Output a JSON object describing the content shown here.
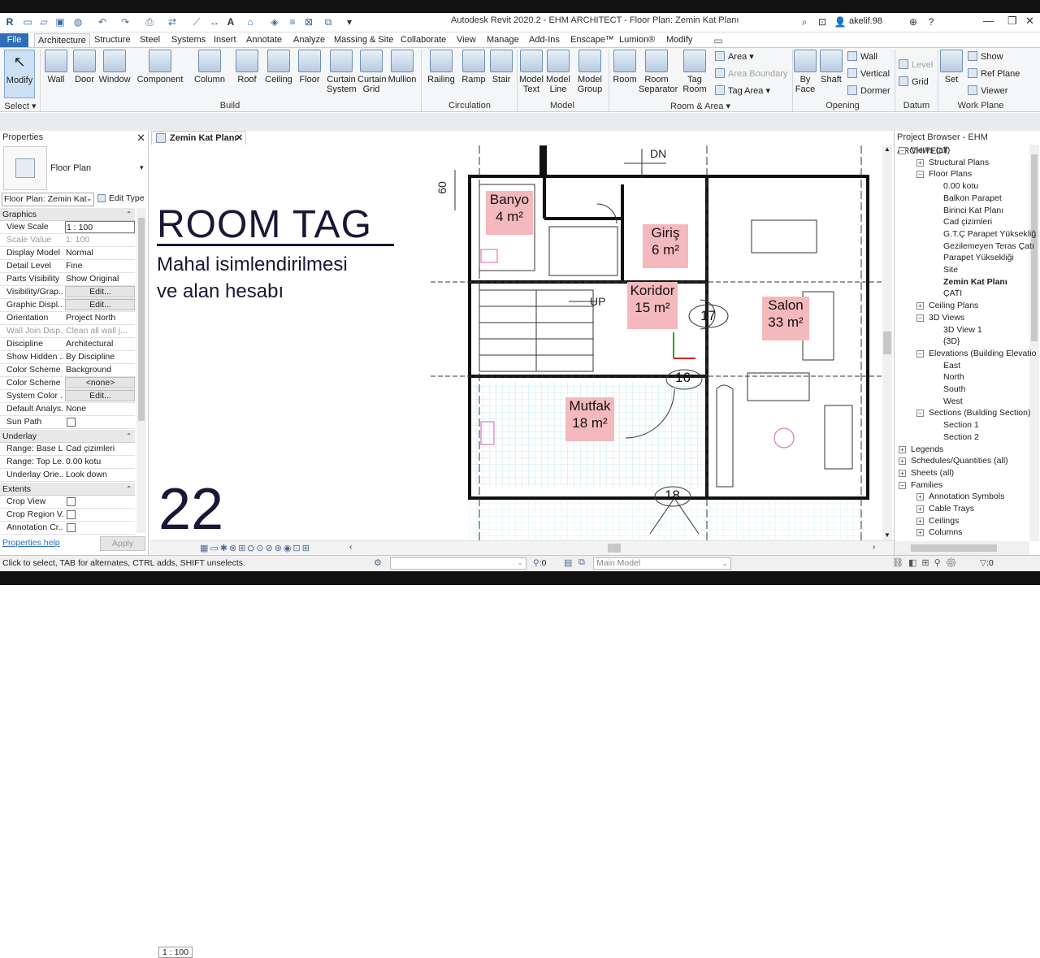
{
  "app": {
    "title": "Autodesk Revit 2020.2 - EHM ARCHITECT - Floor Plan: Zemin Kat Planı",
    "user": "akelif.98"
  },
  "tabs": [
    "File",
    "Architecture",
    "Structure",
    "Steel",
    "Systems",
    "Insert",
    "Annotate",
    "Analyze",
    "Massing & Site",
    "Collaborate",
    "View",
    "Manage",
    "Add-Ins",
    "Enscape™",
    "Lumion®",
    "Modify"
  ],
  "ribbon": {
    "modify": "Modify",
    "select": "Select",
    "build": [
      "Wall",
      "Door",
      "Window",
      "Component",
      "Column",
      "Roof",
      "Ceiling",
      "Floor",
      "Curtain System",
      "Curtain Grid",
      "Mullion"
    ],
    "build_label": "Build",
    "circulation": [
      "Railing",
      "Ramp",
      "Stair"
    ],
    "circulation_label": "Circulation",
    "model": [
      "Model Text",
      "Model Line",
      "Model Group"
    ],
    "model_label": "Model",
    "room": [
      "Room",
      "Room Separator",
      "Tag Room"
    ],
    "room_small": [
      "Area",
      "Area Boundary",
      "Tag Area"
    ],
    "room_label": "Room & Area",
    "opening": [
      "By Face",
      "Shaft"
    ],
    "opening_small": [
      "Wall",
      "Vertical",
      "Dormer"
    ],
    "opening_label": "Opening",
    "datum_small": [
      "Level",
      "Grid"
    ],
    "datum_label": "Datum",
    "workplane": "Set",
    "workplane_small": [
      "Show",
      "Ref Plane",
      "Viewer"
    ],
    "workplane_label": "Work Plane"
  },
  "properties": {
    "title": "Properties",
    "type_name": "Floor Plan",
    "selector": "Floor Plan: Zemin Kat",
    "edit_type": "Edit Type",
    "sections": {
      "graphics": "Graphics",
      "underlay": "Underlay",
      "extents": "Extents"
    },
    "graphics_rows": [
      {
        "k": "View Scale",
        "v": "1 : 100"
      },
      {
        "k": "Scale Value",
        "v": "1:    100"
      },
      {
        "k": "Display Model",
        "v": "Normal"
      },
      {
        "k": "Detail Level",
        "v": "Fine"
      },
      {
        "k": "Parts Visibility",
        "v": "Show Original"
      },
      {
        "k": "Visibility/Grap...",
        "v": "Edit..."
      },
      {
        "k": "Graphic Displ...",
        "v": "Edit..."
      },
      {
        "k": "Orientation",
        "v": "Project North"
      },
      {
        "k": "Wall Join Disp...",
        "v": "Clean all wall j..."
      },
      {
        "k": "Discipline",
        "v": "Architectural"
      },
      {
        "k": "Show Hidden ...",
        "v": "By Discipline"
      },
      {
        "k": "Color Scheme ...",
        "v": "Background"
      },
      {
        "k": "Color Scheme",
        "v": "<none>"
      },
      {
        "k": "System Color ...",
        "v": "Edit..."
      },
      {
        "k": "Default Analys...",
        "v": "None"
      },
      {
        "k": "Sun Path",
        "v": ""
      }
    ],
    "underlay_rows": [
      {
        "k": "Range: Base L...",
        "v": "Cad çizimleri"
      },
      {
        "k": "Range: Top Le...",
        "v": "0.00 kotu"
      },
      {
        "k": "Underlay Orie...",
        "v": "Look down"
      }
    ],
    "extents_rows": [
      {
        "k": "Crop View",
        "v": ""
      },
      {
        "k": "Crop Region V...",
        "v": ""
      },
      {
        "k": "Annotation Cr...",
        "v": ""
      }
    ],
    "help": "Properties help",
    "apply": "Apply"
  },
  "view": {
    "tab": "Zemin Kat Planı",
    "overlay_title": "ROOM TAG",
    "overlay_sub1": "Mahal isimlendirilmesi",
    "overlay_sub2": "ve alan hesabı",
    "overlay_num": "22",
    "scale": "1 : 100",
    "labels": {
      "dn": "DN",
      "up": "UP",
      "dim": "60"
    },
    "rooms": [
      {
        "name": "Banyo",
        "area": "4 m²"
      },
      {
        "name": "Giriş",
        "area": "6 m²"
      },
      {
        "name": "Koridor",
        "area": "15 m²"
      },
      {
        "name": "Salon",
        "area": "33 m²"
      },
      {
        "name": "Mutfak",
        "area": "18 m²"
      }
    ],
    "tags": [
      "17",
      "16",
      "18"
    ]
  },
  "browser": {
    "title": "Project Browser - EHM ARCHITECT",
    "items": [
      "Views (all)",
      "Structural Plans",
      "Floor Plans",
      "0.00 kotu",
      "Balkon Parapet",
      "Birinci Kat Planı",
      "Cad çizimleri",
      "G.T.Ç Parapet Yüksekliğ",
      "Gezilemeyen Teras Çatı",
      "Parapet Yüksekliği",
      "Site",
      "Zemin Kat Planı",
      "ÇATI",
      "Ceiling Plans",
      "3D Views",
      "3D View 1",
      "{3D}",
      "Elevations (Building Elevatio",
      "East",
      "North",
      "South",
      "West",
      "Sections (Building Section)",
      "Section 1",
      "Section 2",
      "Legends",
      "Schedules/Quantities (all)",
      "Sheets (all)",
      "Families",
      "Annotation Symbols",
      "Cable Trays",
      "Ceilings",
      "Columns"
    ]
  },
  "status": {
    "hint": "Click to select, TAB for alternates, CTRL adds, SHIFT unselects.",
    "zero1": ":0",
    "model": "Main Model",
    "zero2": ":0"
  }
}
